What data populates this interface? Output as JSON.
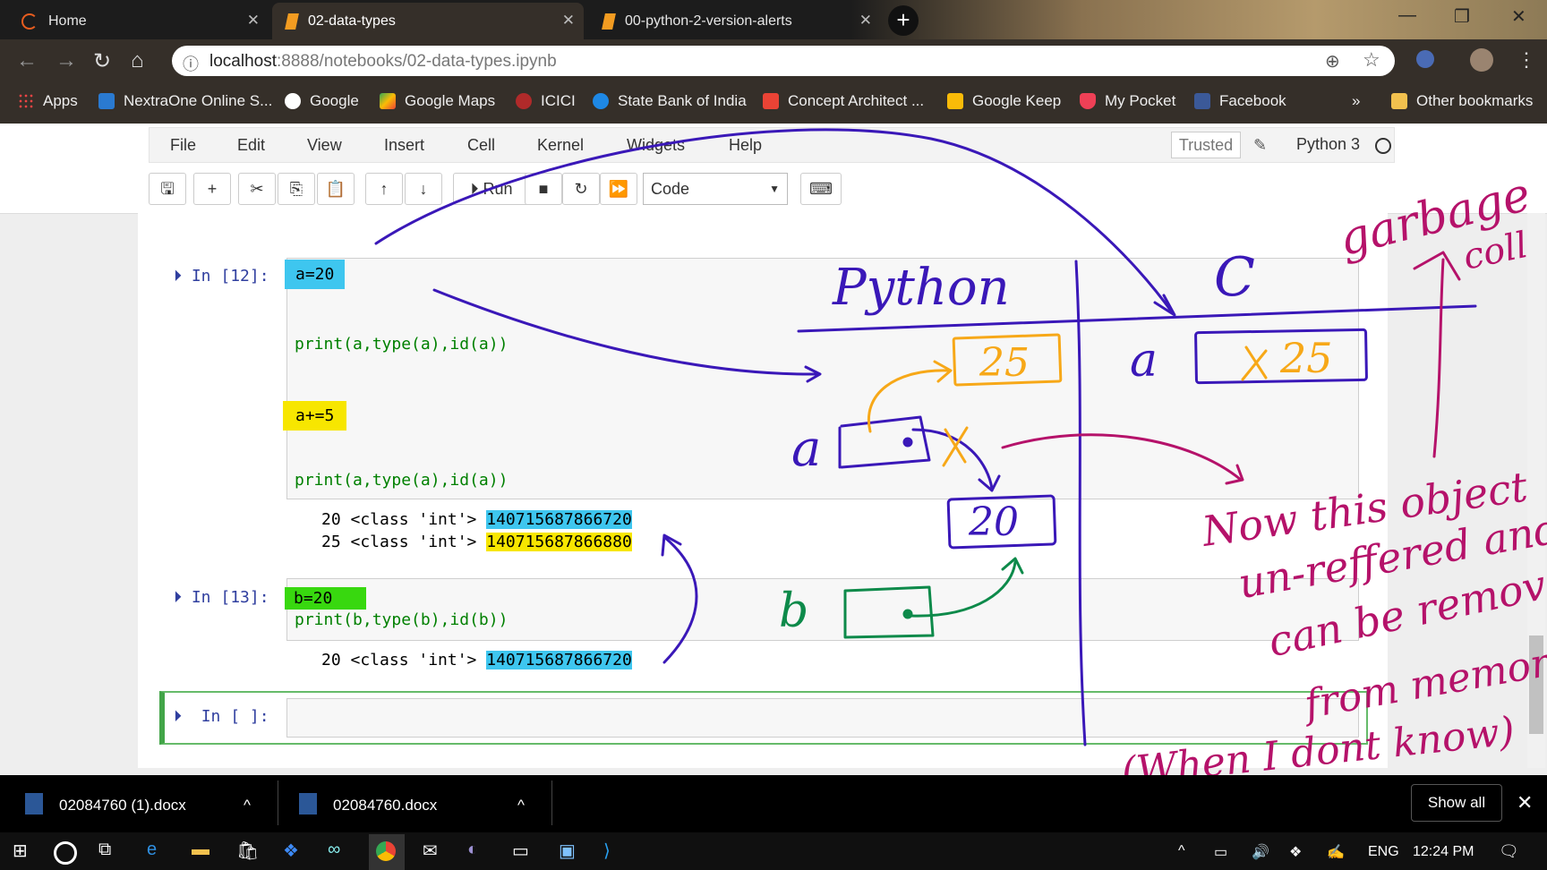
{
  "tabs": [
    {
      "label": "Home",
      "active": false
    },
    {
      "label": "02-data-types",
      "active": true
    },
    {
      "label": "00-python-2-version-alerts",
      "active": false
    }
  ],
  "address": {
    "host": "localhost",
    "rest": ":8888/notebooks/02-data-types.ipynb"
  },
  "bookmarks": [
    "Apps",
    "NextraOne Online S...",
    "Google",
    "Google Maps",
    "ICICI",
    "State Bank of India",
    "Concept Architect ...",
    "Google Keep",
    "My Pocket",
    "Facebook",
    "»",
    "Other bookmarks"
  ],
  "menu": [
    "File",
    "Edit",
    "View",
    "Insert",
    "Cell",
    "Kernel",
    "Widgets",
    "Help"
  ],
  "toolbar": {
    "run_label": "Run",
    "cell_type": "Code",
    "trusted": "Trusted",
    "kernel": "Python 3"
  },
  "cells": [
    {
      "prompt": "In [12]:",
      "lines": [
        "a=20",
        "print(a,type(a),id(a))",
        "a+=5",
        "print(a,type(a),id(a))"
      ],
      "outputs": [
        {
          "text": "20 <class 'int'> ",
          "id": "140715687866720"
        },
        {
          "text": "25 <class 'int'> ",
          "id": "140715687866880"
        }
      ]
    },
    {
      "prompt": "In [13]:",
      "lines": [
        "b=20",
        "print(b,type(b),id(b))"
      ],
      "outputs": [
        {
          "text": "20 <class 'int'> ",
          "id": "140715687866720"
        }
      ]
    },
    {
      "prompt": "In [ ]:",
      "lines": [
        ""
      ],
      "outputs": []
    }
  ],
  "downloads": [
    {
      "name": "02084760 (1).docx"
    },
    {
      "name": "02084760.docx"
    }
  ],
  "download_bar": {
    "show_all": "Show all"
  },
  "taskbar": {
    "lang": "ENG",
    "time": "12:24 PM"
  },
  "annotations": {
    "python": "Python",
    "c": "C",
    "a1": "a",
    "a2": "a",
    "b": "b",
    "v25": "25",
    "v20": "20",
    "box_c": "25",
    "garbage": "garbage",
    "collect": "coll",
    "now": "Now this object",
    "unref": "un-reffered and",
    "can": "can be removed",
    "from": "from memory",
    "when": "(When I dont know)"
  },
  "colors": {
    "accent": "#3ec6ef",
    "highlight_yellow": "#f7e600",
    "highlight_green": "#38d80f",
    "ink_blue": "#3a18b8",
    "ink_orange": "#f7a818",
    "ink_magenta": "#b5126a",
    "ink_green": "#0d8a4a"
  }
}
